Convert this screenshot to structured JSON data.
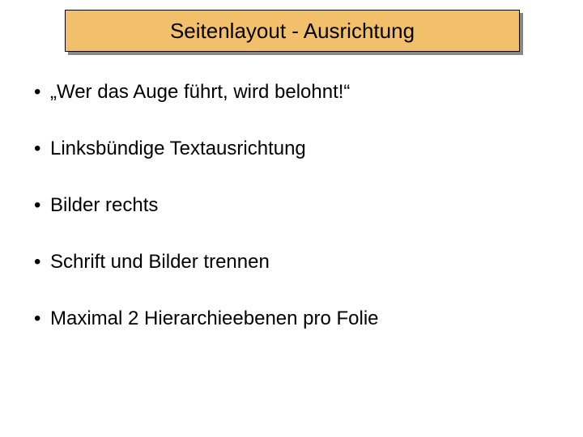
{
  "title": "Seitenlayout - Ausrichtung",
  "bullets": [
    "„Wer das Auge führt, wird belohnt!“",
    "Linksbündige Textausrichtung",
    "Bilder rechts",
    "Schrift und Bilder trennen",
    "Maximal 2 Hierarchieebenen pro Folie"
  ]
}
